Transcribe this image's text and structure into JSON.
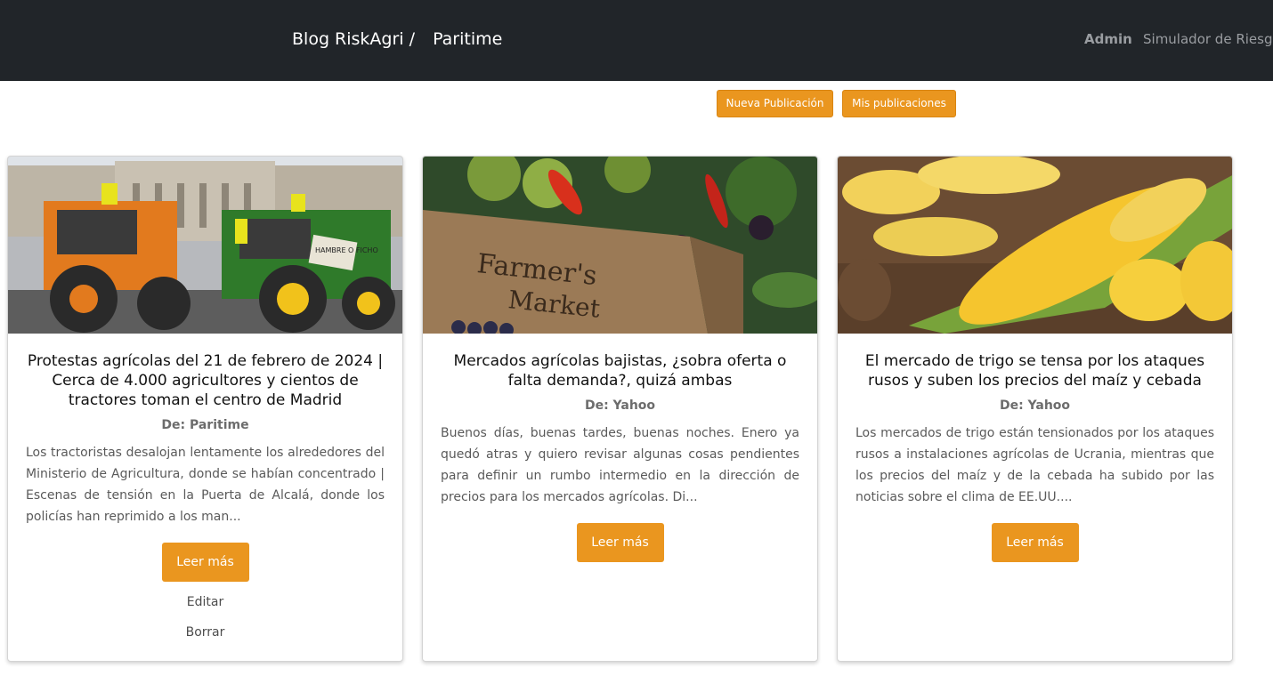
{
  "header": {
    "brand": "Blog RiskAgri /",
    "section": "Paritime",
    "nav_admin": "Admin",
    "nav_simulator": "Simulador de Riesgo"
  },
  "actions": {
    "new_post": "Nueva Publicación",
    "my_posts": "Mis publicaciones"
  },
  "posts": [
    {
      "title": "Protestas agrícolas del 21 de febrero de 2024 | Cerca de 4.000 agricultores y cientos de tractores toman el centro de Madrid",
      "author": "De: Paritime",
      "excerpt": "Los tractoristas desalojan lentamente los alrededores del Ministerio de Agricultura, donde se habían concentrado | Escenas de tensión en la Puerta de Alcalá, donde los policías han reprimido a los man...",
      "read_more": "Leer más",
      "edit": "Editar",
      "delete": "Borrar",
      "image_caption": "HAMBRE O FICHO"
    },
    {
      "title": "Mercados agrícolas bajistas, ¿sobra oferta o falta demanda?, quizá ambas",
      "author": "De: Yahoo",
      "excerpt": "Buenos días, buenas tardes, buenas noches. Enero ya quedó atras y quiero revisar algunas cosas pendientes para definir un rumbo intermedio en la dirección de precios para los mercados agrícolas. Di...",
      "read_more": "Leer más",
      "image_caption_1": "Farmer's",
      "image_caption_2": "Market"
    },
    {
      "title": "El mercado de trigo se tensa por los ataques rusos y suben los precios del maíz y cebada",
      "author": "De: Yahoo",
      "excerpt": "Los mercados de trigo están tensionados por los ataques rusos a instalaciones agrícolas de Ucrania, mientras que los precios del maíz y de la cebada ha subido por las noticias sobre el clima de EE.UU....",
      "read_more": "Leer más"
    }
  ],
  "colors": {
    "navbar": "#212529",
    "accent": "#ea961f"
  }
}
